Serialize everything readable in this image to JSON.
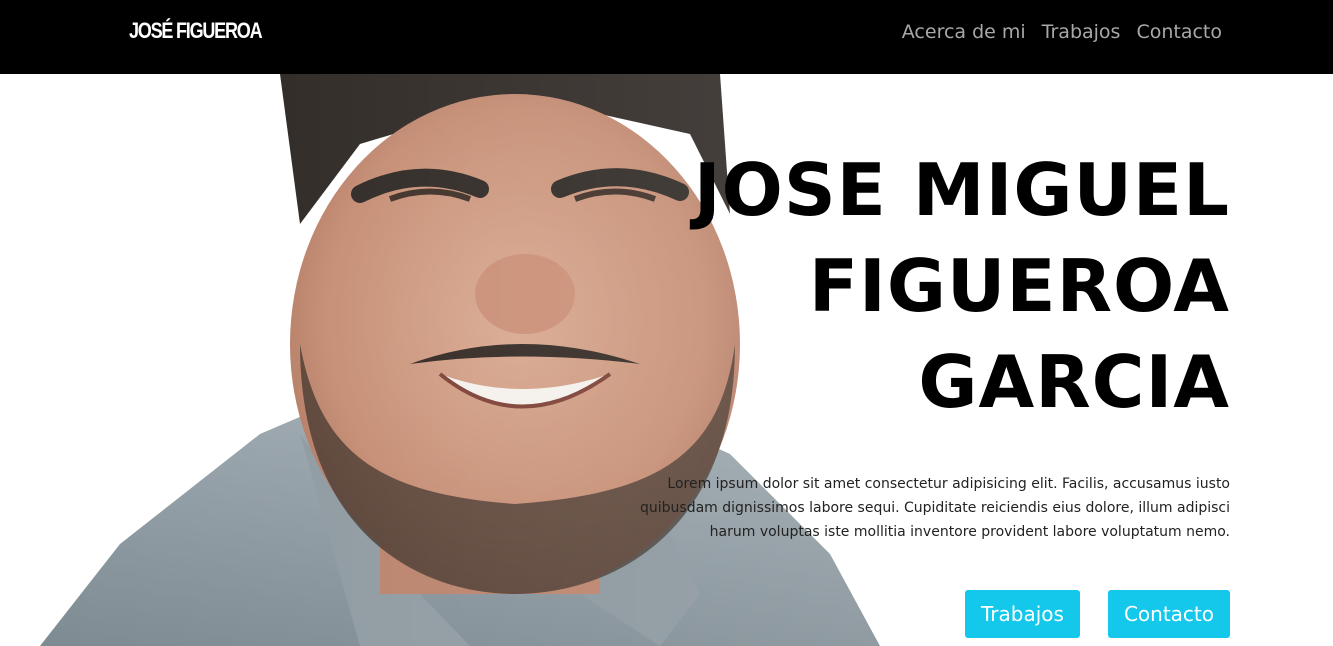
{
  "navbar": {
    "brand": "JOSÉ FIGUEROA",
    "links": [
      {
        "label": "Acerca de mi"
      },
      {
        "label": "Trabajos"
      },
      {
        "label": "Contacto"
      }
    ]
  },
  "hero": {
    "title_lines": [
      "JOSE MIGUEL",
      "FIGUEROA",
      "GARCIA"
    ],
    "description": "Lorem ipsum dolor sit amet consectetur adipisicing elit. Facilis, accusamus iusto quibusdam dignissimos labore sequi. Cupiditate reiciendis eius dolore, illum adipisci harum voluptas iste mollitia inventore provident labore voluptatum nemo.",
    "buttons": [
      {
        "label": "Trabajos"
      },
      {
        "label": "Contacto"
      }
    ]
  },
  "colors": {
    "navbar_bg": "#000000",
    "nav_link": "#a8a8a8",
    "button_bg": "#14c8ec",
    "title": "#000000"
  }
}
